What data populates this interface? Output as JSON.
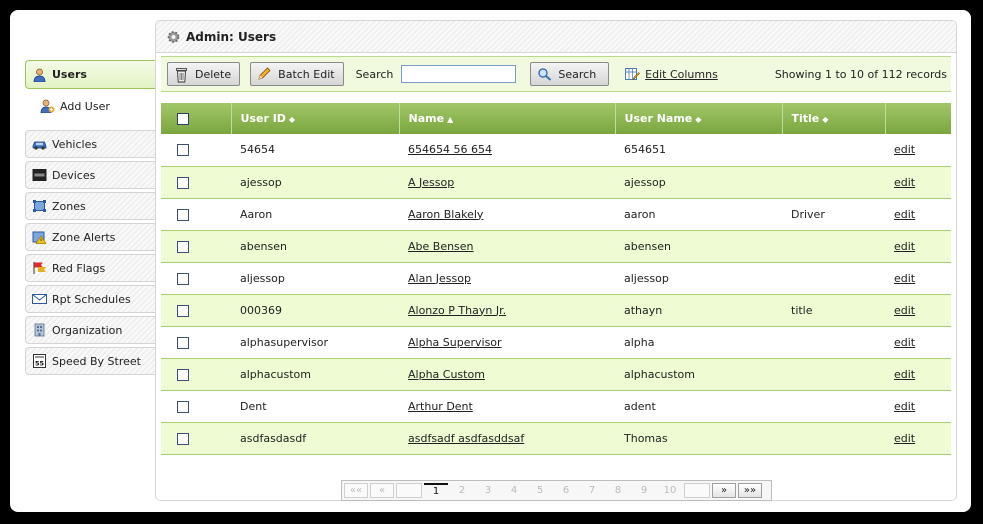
{
  "panel": {
    "title": "Admin: Users"
  },
  "sidebar": {
    "items": [
      {
        "label": "Users",
        "icon": "user-icon"
      },
      {
        "label": "Add User",
        "icon": "add-user-icon"
      },
      {
        "label": "Vehicles",
        "icon": "car-icon"
      },
      {
        "label": "Devices",
        "icon": "device-icon"
      },
      {
        "label": "Zones",
        "icon": "zones-icon"
      },
      {
        "label": "Zone Alerts",
        "icon": "zone-alert-icon"
      },
      {
        "label": "Red Flags",
        "icon": "red-flag-icon"
      },
      {
        "label": "Rpt Schedules",
        "icon": "mail-icon"
      },
      {
        "label": "Organization",
        "icon": "building-icon"
      },
      {
        "label": "Speed By Street",
        "icon": "speed-sign-icon"
      }
    ]
  },
  "toolbar": {
    "delete_label": "Delete",
    "batch_edit_label": "Batch Edit",
    "search_label": "Search",
    "search_value": "",
    "search_button_label": "Search",
    "edit_columns_label": "Edit Columns",
    "records_text": "Showing 1 to 10 of 112 records"
  },
  "table": {
    "columns": [
      "User ID",
      "Name",
      "User Name",
      "Title",
      ""
    ],
    "edit_label": "edit",
    "rows": [
      {
        "user_id": "54654",
        "name": "654654 56 654",
        "username": "654651",
        "title": ""
      },
      {
        "user_id": "ajessop",
        "name": "A Jessop",
        "username": "ajessop",
        "title": ""
      },
      {
        "user_id": "Aaron",
        "name": "Aaron Blakely",
        "username": "aaron",
        "title": "Driver"
      },
      {
        "user_id": "abensen",
        "name": "Abe Bensen",
        "username": "abensen",
        "title": ""
      },
      {
        "user_id": "aljessop",
        "name": "Alan Jessop",
        "username": "aljessop",
        "title": ""
      },
      {
        "user_id": "000369",
        "name": "Alonzo P Thayn Jr.",
        "username": "athayn",
        "title": "title"
      },
      {
        "user_id": "alphasupervisor",
        "name": "Alpha Supervisor",
        "username": "alpha",
        "title": ""
      },
      {
        "user_id": "alphacustom",
        "name": "Alpha Custom",
        "username": "alphacustom",
        "title": ""
      },
      {
        "user_id": "Dent",
        "name": "Arthur Dent",
        "username": "adent",
        "title": ""
      },
      {
        "user_id": "asdfasdasdf",
        "name": "asdfsadf asdfasddsaf",
        "username": "Thomas",
        "title": ""
      }
    ]
  },
  "pager": {
    "first": "««",
    "prev": "«",
    "next": "»",
    "last": "»»",
    "pages": [
      "1",
      "2",
      "3",
      "4",
      "5",
      "6",
      "7",
      "8",
      "9",
      "10"
    ],
    "current": "1"
  },
  "colors": {
    "header_green": "#8ab44f",
    "row_alt": "#eefbd3",
    "toolbar_bg": "#f1fadf"
  }
}
